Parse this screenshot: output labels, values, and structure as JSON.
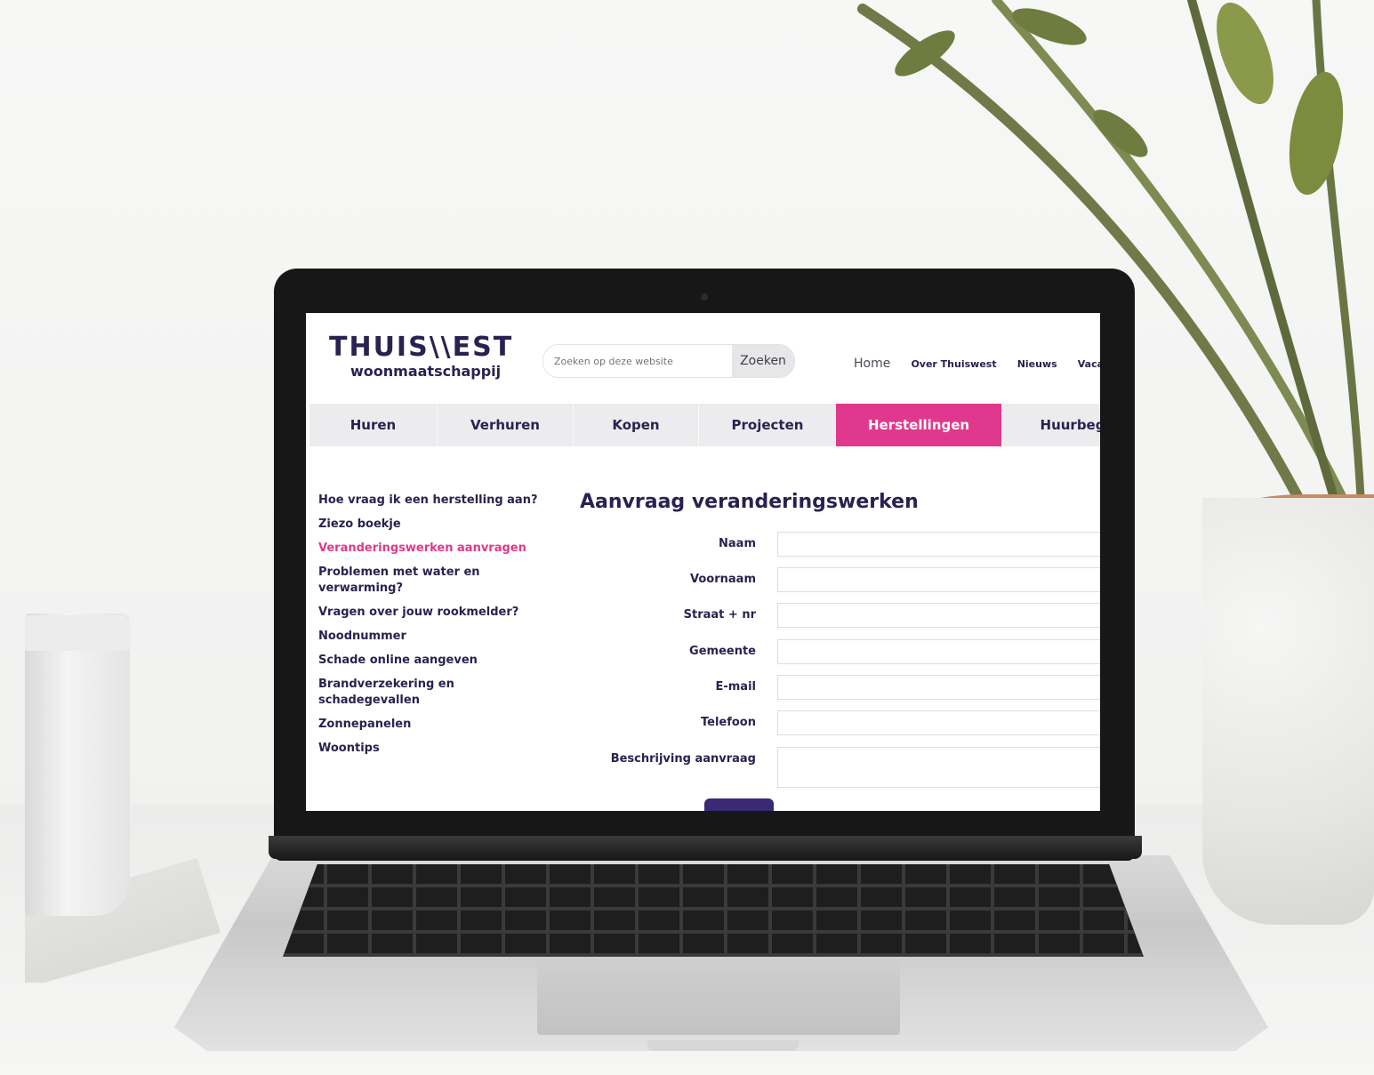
{
  "site": {
    "logo": {
      "name": "THUIS\\\\EST",
      "tagline": "woonmaatschappij"
    },
    "search": {
      "placeholder": "Zoeken op deze website",
      "button_label": "Zoeken"
    },
    "top_nav": [
      "Home",
      "Over Thuiswest",
      "Nieuws",
      "Vacatu"
    ],
    "main_nav": {
      "tabs": [
        "Huren",
        "Verhuren",
        "Kopen",
        "Projecten",
        "Herstellingen",
        "Huurbeg"
      ],
      "active": "Herstellingen"
    },
    "side_nav": {
      "items": [
        "Hoe vraag ik een herstelling aan?",
        "Ziezo boekje",
        "Veranderingswerken aanvragen",
        "Problemen met water en verwarming?",
        "Vragen over jouw rookmelder?",
        "Noodnummer",
        "Schade online aangeven",
        "Brandverzekering en schadegevallen",
        "Zonnepanelen",
        "Woontips"
      ],
      "active": "Veranderingswerken aanvragen"
    },
    "form": {
      "title": "Aanvraag veranderingswerken",
      "fields": [
        {
          "label": "Naam",
          "value": ""
        },
        {
          "label": "Voornaam",
          "value": ""
        },
        {
          "label": "Straat + nr",
          "value": ""
        },
        {
          "label": "Gemeente",
          "value": ""
        },
        {
          "label": "E-mail",
          "value": ""
        },
        {
          "label": "Telefoon",
          "value": ""
        },
        {
          "label": "Beschrijving aanvraag",
          "value": ""
        }
      ]
    },
    "colors": {
      "brand": "#2b2150",
      "accent": "#e0388c",
      "button": "#3b2a73"
    }
  }
}
